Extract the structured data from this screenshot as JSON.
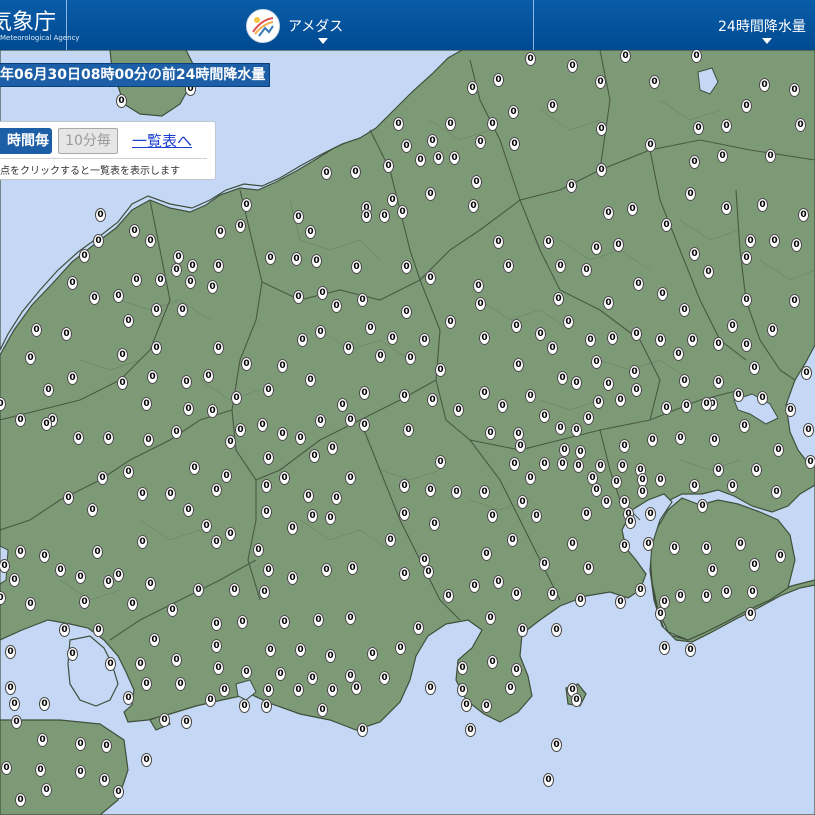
{
  "header": {
    "agency_name": "気象庁",
    "agency_sub": "Meteorological Agency",
    "mode_label": "アメダス",
    "element_label": "24時間降水量"
  },
  "title": "年06月30日08時00分の前24時間降水量",
  "controls": {
    "interval_active": "時間毎",
    "interval_inactive": "10分毎",
    "list_link": "一覧表へ",
    "hint": "点をクリックすると一覧表を表示します"
  },
  "station_value": "0",
  "colors": {
    "header": "#004a92",
    "land": "#7d9a76",
    "sea": "#c4d8f6",
    "title_bg": "#1d5fa6"
  },
  "icons": [
    "amedas-logo-icon",
    "chevron-down-icon"
  ]
}
